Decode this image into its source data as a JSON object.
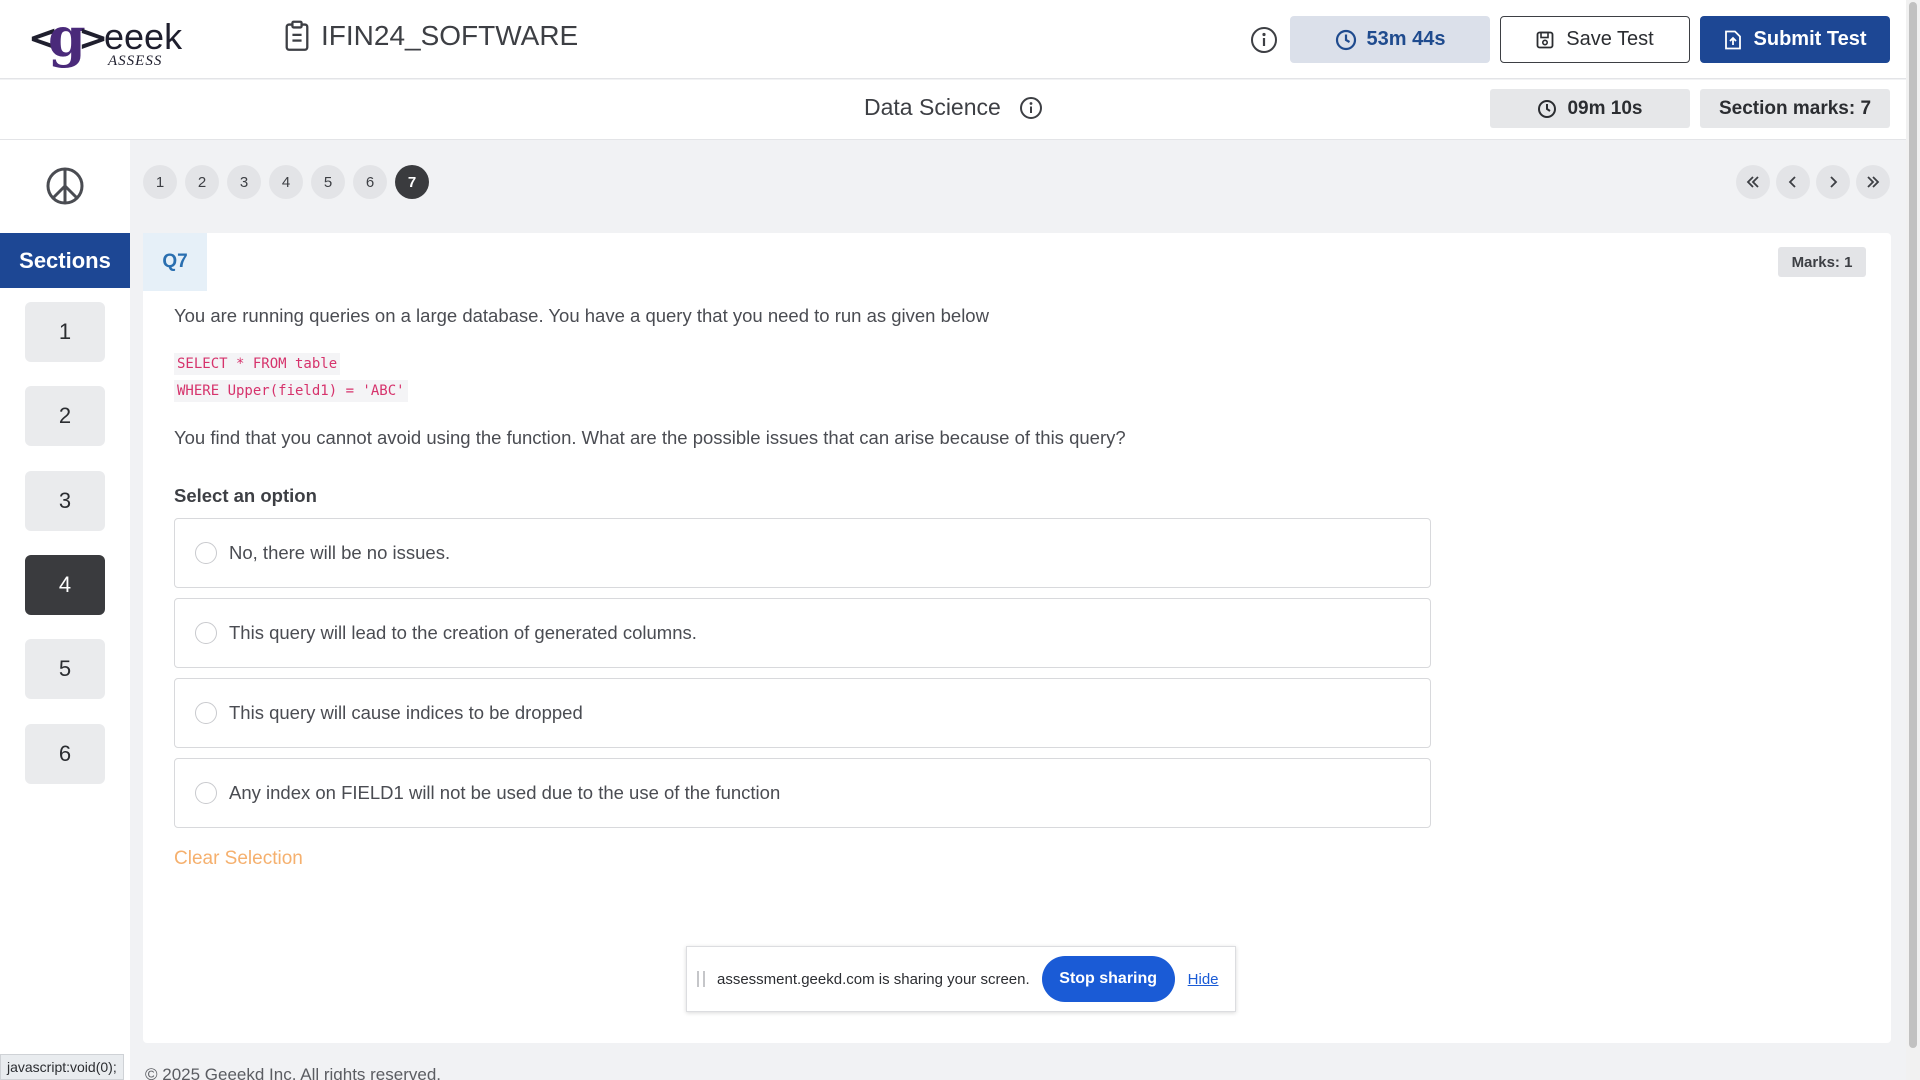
{
  "header": {
    "logo_brand": "<g>eeek",
    "logo_sub": "ASSESS",
    "test_title": "IFIN24_SOFTWARE",
    "overall_timer": "53m 44s",
    "save_label": "Save Test",
    "submit_label": "Submit Test",
    "accent_color": "#1d4794"
  },
  "section_bar": {
    "title": "Data Science",
    "section_timer": "09m 10s",
    "section_marks": "Section marks: 7"
  },
  "sidebar": {
    "sections_label": "Sections",
    "items": [
      {
        "label": "1",
        "active": false
      },
      {
        "label": "2",
        "active": false
      },
      {
        "label": "3",
        "active": false
      },
      {
        "label": "4",
        "active": true
      },
      {
        "label": "5",
        "active": false
      },
      {
        "label": "6",
        "active": false
      }
    ]
  },
  "question_nav": {
    "items": [
      "1",
      "2",
      "3",
      "4",
      "5",
      "6",
      "7"
    ],
    "current": "7"
  },
  "question": {
    "label": "Q7",
    "marks": "Marks: 1",
    "text": "You are running queries on a large database. You have a query that you need to run as given below",
    "code_lines": [
      "SELECT * FROM table",
      "WHERE Upper(field1) = 'ABC'"
    ],
    "text2": "You find that you cannot avoid using the function. What are the possible issues that can arise because of this query?",
    "select_label": "Select an option",
    "options": [
      "No, there will be no issues.",
      "This query will lead to the creation of generated columns.",
      "This query will cause indices to be dropped",
      "Any index on FIELD1 will not be used due to the use of the function"
    ],
    "clear_label": "Clear Selection"
  },
  "screen_share": {
    "message": "assessment.geekd.com is sharing your screen.",
    "stop_label": "Stop sharing",
    "hide_label": "Hide"
  },
  "footer": {
    "copyright": "© 2025 Geeekd Inc. All rights reserved."
  },
  "status_bar": {
    "url": "javascript:void(0);"
  }
}
